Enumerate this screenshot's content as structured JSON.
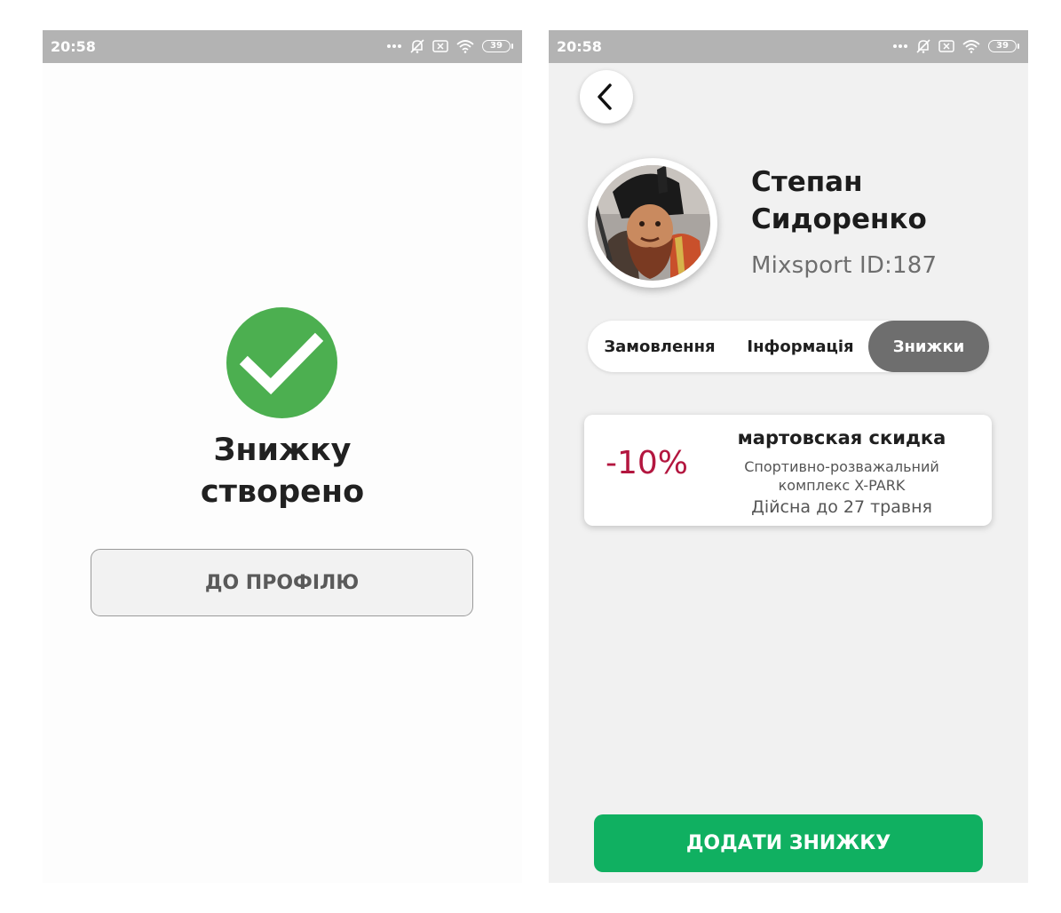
{
  "screens": {
    "success": {
      "status_bar": {
        "time": "20:58",
        "battery": "39"
      },
      "icon": "check-circle-icon",
      "title_line1": "Знижку",
      "title_line2": "створено",
      "to_profile_label": "ДО ПРОФІЛЮ",
      "colors": {
        "check": "#4caf50"
      }
    },
    "profile": {
      "status_bar": {
        "time": "20:58",
        "battery": "39"
      },
      "back_icon": "chevron-left-icon",
      "user": {
        "first_name": "Степан",
        "last_name": "Сидоренко",
        "id_text": "Mixsport ID:187"
      },
      "tabs": [
        {
          "label": "Замовлення",
          "active": false
        },
        {
          "label": "Інформація",
          "active": false
        },
        {
          "label": "Знижки",
          "active": true
        }
      ],
      "discounts": [
        {
          "percent": "-10%",
          "title": "мартовская скидка",
          "place_line1": "Спортивно-розважальний",
          "place_line2": "комплекс X-PARK",
          "valid": "Дійсна до 27 травня"
        }
      ],
      "add_discount_label": "ДОДАТИ ЗНИЖКУ",
      "colors": {
        "accent": "#10b061",
        "discount": "#b3163f",
        "tab_active": "#6e6e6e"
      }
    }
  }
}
